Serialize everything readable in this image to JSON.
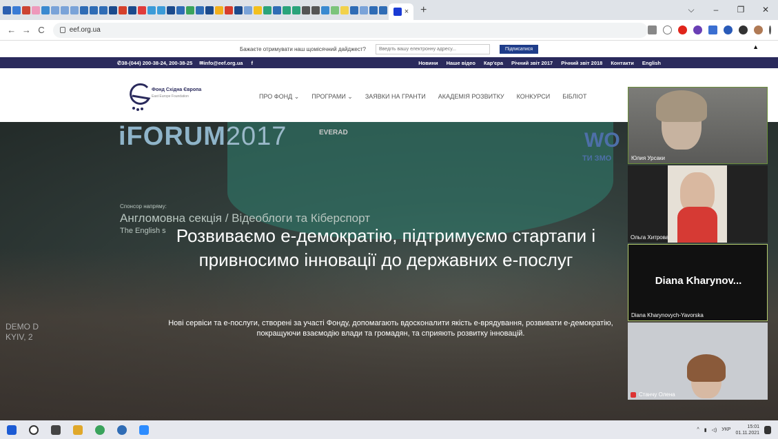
{
  "browser": {
    "url": "eef.org.ua",
    "tab_close": "×",
    "new_tab": "+",
    "window_controls": [
      "⌵",
      "–",
      "❐",
      "✕"
    ],
    "nav": {
      "back": "←",
      "forward": "→",
      "reload": "C"
    }
  },
  "site": {
    "subscribe": {
      "prompt": "Бажаєте отримувати наш щомісячний дайджест?",
      "placeholder": "Введіть вашу електронну адресу...",
      "button": "Підписатися"
    },
    "contacts": {
      "phone": "✆38-(044) 200-38-24, 200-38-25",
      "email": "✉info@eef.org.ua",
      "facebook": "f"
    },
    "toplinks": [
      "Новини",
      "Наше відео",
      "Кар'єра",
      "Річний звіт 2017",
      "Річний звіт 2018",
      "Контакти",
      "English"
    ],
    "logo": {
      "name": "Фонд Східна Європа",
      "subtitle": "East Europe Foundation"
    },
    "mainnav": [
      "ПРО ФОНД ⌄",
      "ПРОГРАМИ ⌄",
      "ЗАЯВКИ НА ГРАНТИ",
      "АКАДЕМІЯ РОЗВИТКУ",
      "КОНКУРСИ",
      "БІБЛІОТ"
    ],
    "hero": {
      "banner_left": "iFORUM",
      "banner_year": "2017",
      "banner_sponsor": "EVERAD",
      "banner_right": "WO",
      "banner_right_sub": "ТИ ЗМО",
      "section_small": "Спонсор напряму:",
      "section_big": "Англомовна секція / Відеоблоги та Кіберспорт",
      "section_en": "The English s",
      "demo_line1": "DEMO D",
      "demo_line2": "KYIV, 2",
      "title": "Розвиваємо е-демократію, підтримуємо стартапи і привносимо інновації до державних е-послуг",
      "text": "Нові сервіси та е-послуги, створені за участі Фонду, допомагають вдосконалити якість е-врядування, розвивати е-демократію, покращуючи взаємодію влади та громадян, та сприяють розвитку інновацій."
    }
  },
  "call": {
    "participants": [
      {
        "name": "Юлия Урсаки"
      },
      {
        "name": "Ольга Хитрова"
      },
      {
        "name": "Diana Kharynovych-Yavorska",
        "display": "Diana  Kharynov..."
      },
      {
        "name": "Станчу Олена"
      }
    ]
  },
  "taskbar": {
    "time": "15:01",
    "date": "01.11.2021",
    "lang": "УКР"
  }
}
